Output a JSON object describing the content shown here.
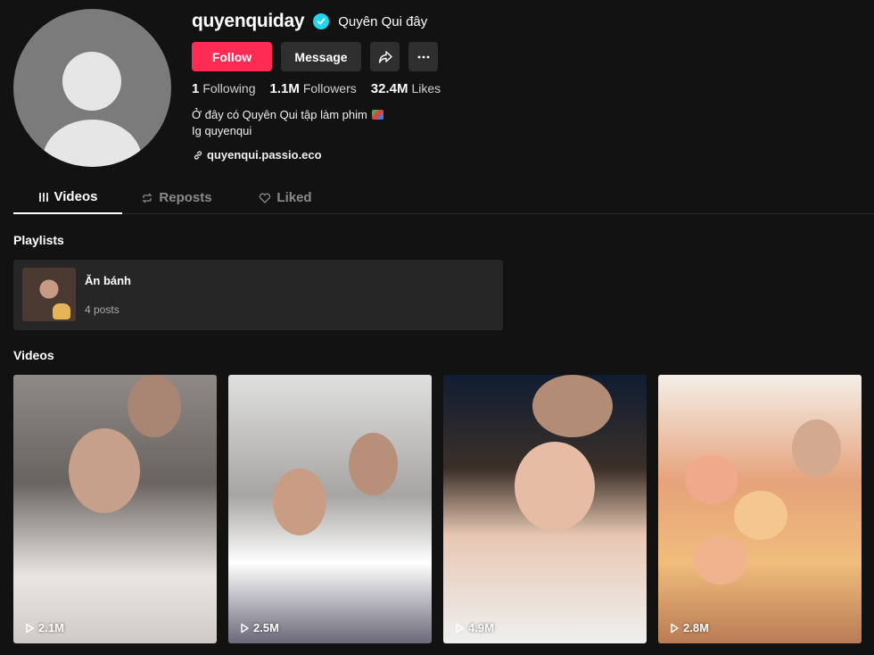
{
  "profile": {
    "username": "quyenquiday",
    "nickname": "Quyên Qui đây",
    "verified": true,
    "follow_label": "Follow",
    "message_label": "Message",
    "stats": [
      {
        "value": "1",
        "label": "Following"
      },
      {
        "value": "1.1M",
        "label": "Followers"
      },
      {
        "value": "32.4M",
        "label": "Likes"
      }
    ],
    "bio_line1": "Ở đây có Quyên Qui tập làm phim",
    "bio_line2": "Ig quyenqui",
    "link": "quyenqui.passio.eco"
  },
  "tabs": [
    {
      "label": "Videos",
      "icon": "grid-icon",
      "active": true
    },
    {
      "label": "Reposts",
      "icon": "repost-icon",
      "active": false
    },
    {
      "label": "Liked",
      "icon": "heart-icon",
      "active": false
    }
  ],
  "playlists_title": "Playlists",
  "playlist": {
    "name": "Ăn bánh",
    "count": "4 posts"
  },
  "videos_title": "Videos",
  "videos": [
    {
      "views": "2.1M"
    },
    {
      "views": "2.5M"
    },
    {
      "views": "4.9M"
    },
    {
      "views": "2.8M"
    }
  ],
  "colors": {
    "background": "#121212",
    "follow_button": "#fe2c55",
    "verified_badge": "#20d5ec"
  }
}
